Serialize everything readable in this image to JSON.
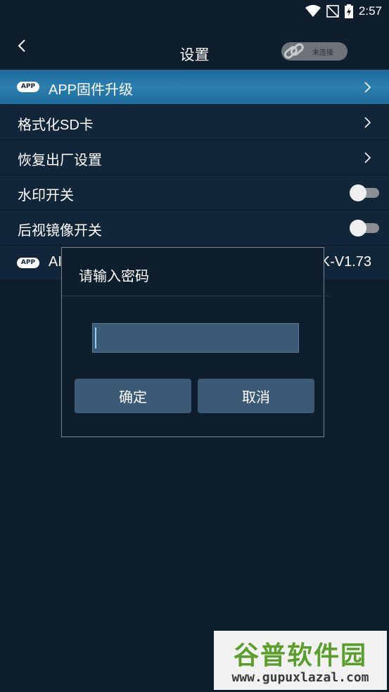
{
  "status_bar": {
    "time": "2:57",
    "icons": [
      "wifi-icon",
      "no-signal-icon",
      "battery-charging-icon"
    ]
  },
  "header": {
    "title": "设置",
    "connection_label": "未连接"
  },
  "menu": {
    "items": [
      {
        "label": "APP固件升级",
        "badge": "APP",
        "type": "chevron"
      },
      {
        "label": "格式化SD卡",
        "type": "chevron"
      },
      {
        "label": "恢复出厂设置",
        "type": "chevron"
      },
      {
        "label": "水印开关",
        "type": "toggle",
        "on": false
      },
      {
        "label": "后视镜像开关",
        "type": "toggle",
        "on": false
      },
      {
        "label": "AI",
        "badge": "APP",
        "version": "K-V1.73",
        "type": "info"
      }
    ]
  },
  "dialog": {
    "title": "请输入密码",
    "password_value": "",
    "confirm_label": "确定",
    "cancel_label": "取消"
  },
  "watermark": {
    "top": "谷普软件园",
    "bottom": "www.gupuxlazal.com"
  },
  "colors": {
    "background": "#0f1e2d",
    "active_row": "#2c7fae",
    "button": "#3b5a76"
  }
}
